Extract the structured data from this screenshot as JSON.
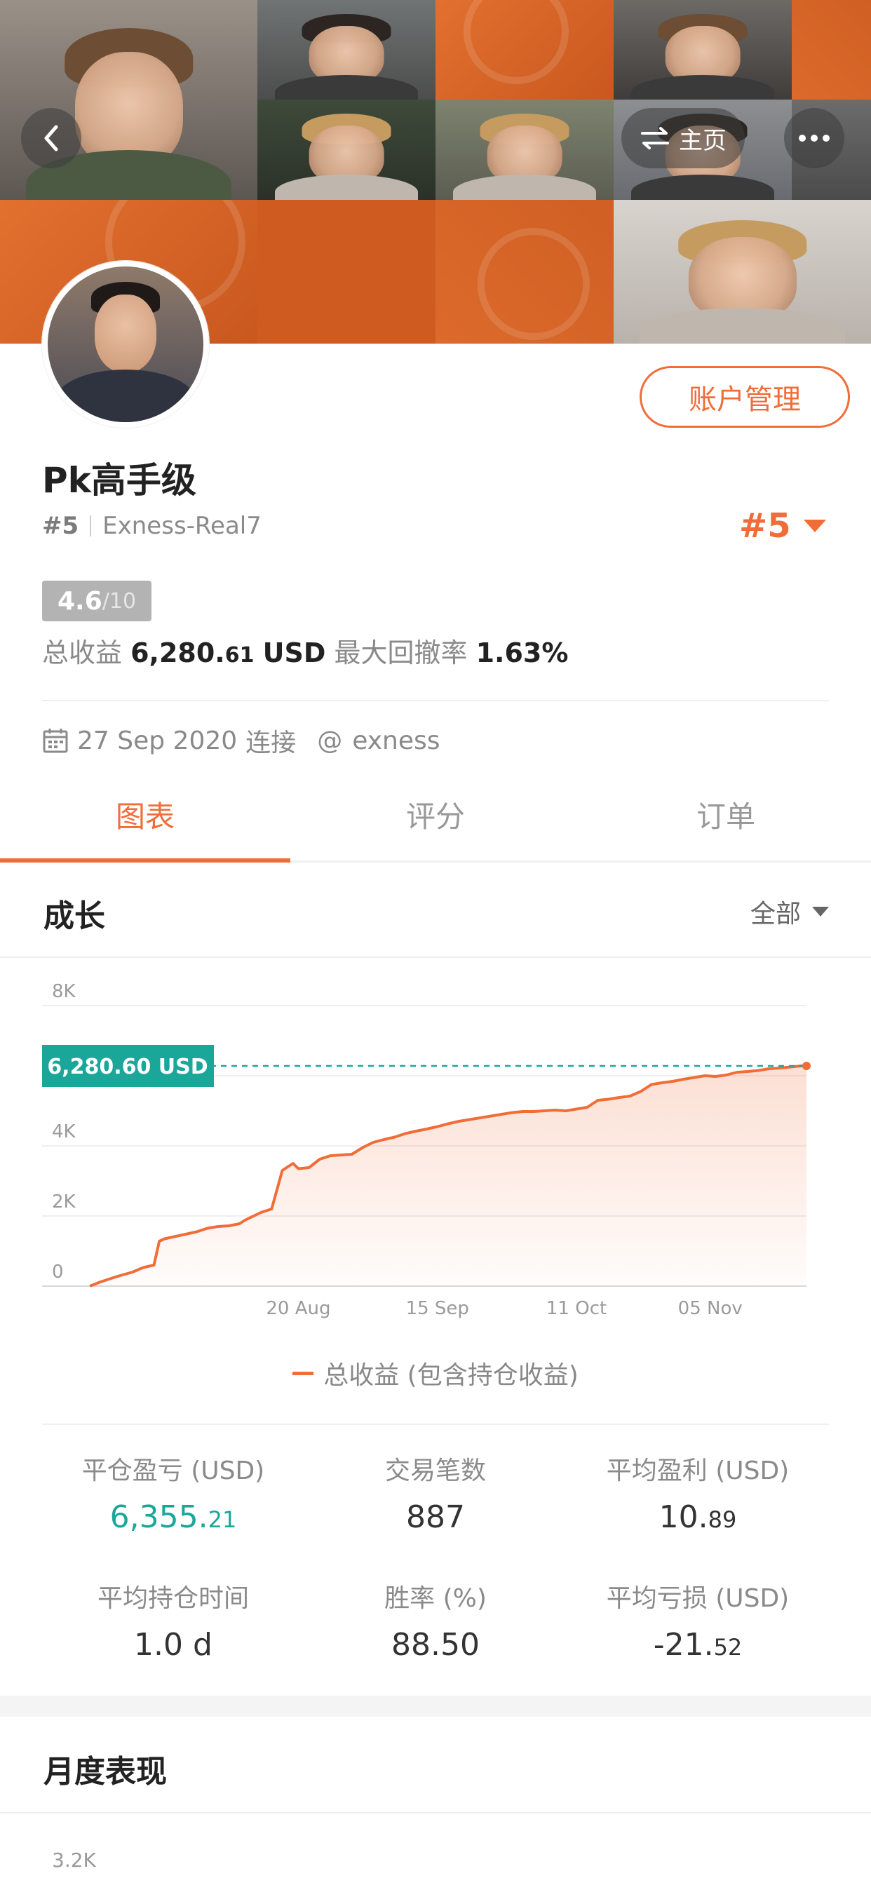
{
  "header": {
    "home_label": "主页",
    "account_button": "账户管理"
  },
  "profile": {
    "name": "Pk高手级",
    "rank": "#5",
    "server": "Exness-Real7",
    "rank_right": "#5",
    "score_value": "4.6",
    "score_denominator": "/10",
    "total_profit_label": "总收益",
    "total_profit_int": "6,280.",
    "total_profit_dec": "61",
    "total_profit_unit": "USD",
    "max_drawdown_label": "最大回撤率",
    "max_drawdown_value": "1.63%",
    "connected_date": "27 Sep 2020",
    "connected_label": "连接",
    "broker": "exness"
  },
  "tabs": [
    {
      "label": "图表",
      "active": true
    },
    {
      "label": "评分",
      "active": false
    },
    {
      "label": "订单",
      "active": false
    }
  ],
  "growth": {
    "title": "成长",
    "filter": "全部",
    "current_label": "6,280.60 USD",
    "legend": "总收益 (包含持仓收益)"
  },
  "chart_data": {
    "type": "area",
    "ylim": [
      0,
      8000
    ],
    "y_ticks": [
      "0",
      "2K",
      "4K",
      "",
      "8K"
    ],
    "x_ticks": [
      "20 Aug",
      "15 Sep",
      "11 Oct",
      "05 Nov"
    ],
    "x_tick_days": [
      39,
      65,
      91,
      116
    ],
    "x": [
      0,
      2,
      5,
      8,
      10,
      12,
      13,
      14,
      17,
      20,
      22,
      24,
      26,
      28,
      29,
      32,
      34,
      36,
      38,
      39,
      41,
      43,
      45,
      47,
      49,
      51,
      53,
      55,
      57,
      59,
      61,
      63,
      65,
      67,
      69,
      71,
      73,
      75,
      77,
      79,
      81,
      83,
      85,
      87,
      89,
      91,
      93,
      95,
      97,
      99,
      101,
      103,
      105,
      107,
      109,
      111,
      113,
      115,
      117,
      119,
      121,
      123,
      125,
      127,
      129,
      131,
      133,
      134
    ],
    "y": [
      0,
      120,
      270,
      400,
      530,
      600,
      1280,
      1350,
      1450,
      1550,
      1650,
      1700,
      1720,
      1780,
      1880,
      2100,
      2200,
      3300,
      3500,
      3350,
      3380,
      3620,
      3720,
      3740,
      3760,
      3950,
      4100,
      4180,
      4250,
      4350,
      4420,
      4480,
      4550,
      4630,
      4700,
      4750,
      4800,
      4850,
      4900,
      4950,
      4980,
      4980,
      5000,
      5020,
      5000,
      5050,
      5100,
      5300,
      5330,
      5380,
      5420,
      5550,
      5750,
      5800,
      5840,
      5900,
      5950,
      6000,
      5980,
      6020,
      6100,
      6120,
      6150,
      6200,
      6220,
      6250,
      6280,
      6280
    ]
  },
  "summary": [
    {
      "label": "平仓盈亏 (USD)",
      "int": "6,355.",
      "dec": "21"
    },
    {
      "label": "交易笔数",
      "int": "887",
      "dec": ""
    },
    {
      "label": "平均盈利 (USD)",
      "int": "10.",
      "dec": "89"
    },
    {
      "label": "平均持仓时间",
      "int": "1.0 d",
      "dec": ""
    },
    {
      "label": "胜率 (%)",
      "int": "88.50",
      "dec": ""
    },
    {
      "label": "平均亏损 (USD)",
      "int": "-21.",
      "dec": "52"
    }
  ],
  "monthly": {
    "title": "月度表现",
    "first_tick": "3.2K"
  },
  "colors": {
    "accent": "#f06d38",
    "green": "#1aa79a"
  }
}
